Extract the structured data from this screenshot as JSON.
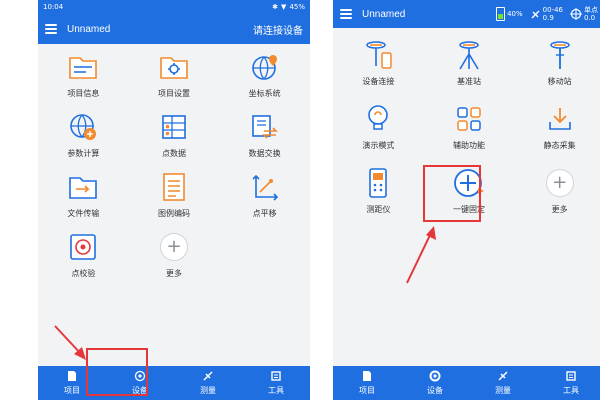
{
  "left": {
    "status": {
      "time": "10:04",
      "battery": "45%"
    },
    "header": {
      "title": "Unnamed",
      "connect": "请连接设备"
    },
    "grid": [
      "项目信息",
      "项目设置",
      "坐标系统",
      "参数计算",
      "点数据",
      "数据交换",
      "文件传输",
      "图例编码",
      "点平移",
      "点校验",
      "更多"
    ],
    "tabs": [
      "项目",
      "设备",
      "测量",
      "工具"
    ]
  },
  "right": {
    "header": {
      "title": "Unnamed"
    },
    "status": {
      "battery": "40%",
      "sat_top": "00-46",
      "sat_bottom": "0.9",
      "mode": "单点",
      "mode_value": "0.0"
    },
    "grid": [
      "设备连接",
      "基准站",
      "移动站",
      "演示模式",
      "辅助功能",
      "静态采集",
      "测距仪",
      "一键固定",
      "更多"
    ],
    "tabs": [
      "项目",
      "设备",
      "测量",
      "工具"
    ]
  },
  "colors": {
    "primary": "#1f6fe0",
    "highlight": "#e5373a",
    "battery_fill": "#6fe13b"
  }
}
